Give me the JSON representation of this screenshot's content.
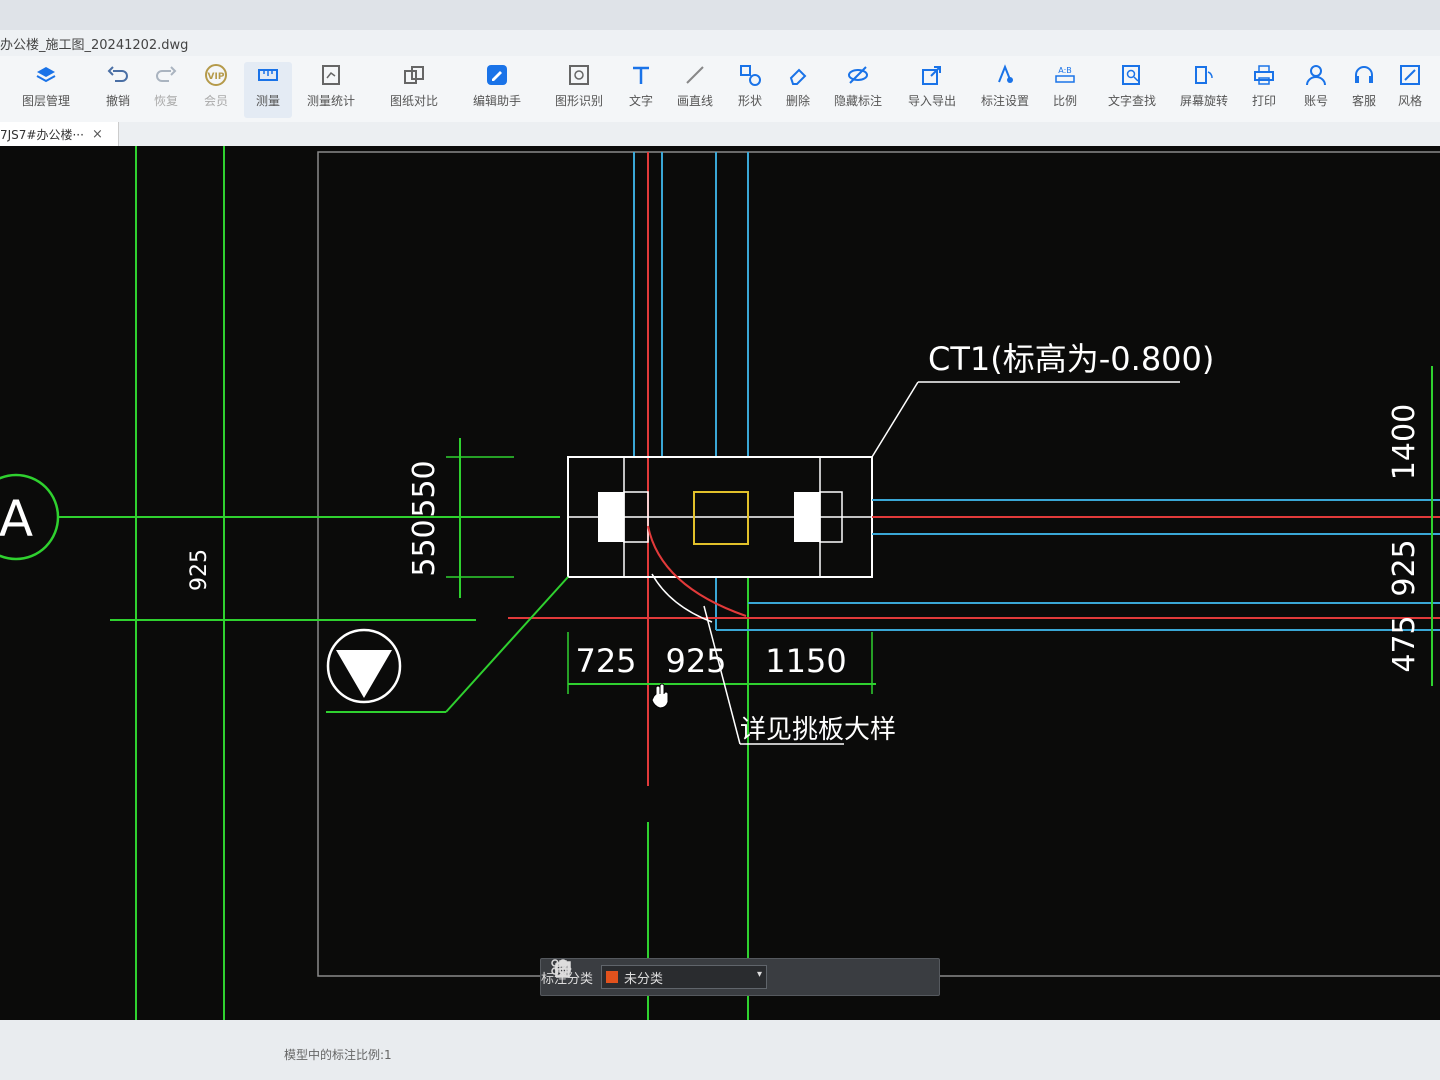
{
  "window": {
    "title": "办公楼_施工图_20241202.dwg"
  },
  "toolbar": {
    "items": [
      {
        "label": "图层管理",
        "icon": "layers-icon"
      },
      {
        "label": "撤销",
        "icon": "undo-icon"
      },
      {
        "label": "恢复",
        "icon": "redo-icon"
      },
      {
        "label": "会员",
        "icon": "vip-icon"
      },
      {
        "label": "测量",
        "icon": "measure-icon"
      },
      {
        "label": "测量统计",
        "icon": "measure-stats-icon"
      },
      {
        "label": "图纸对比",
        "icon": "compare-icon"
      },
      {
        "label": "编辑助手",
        "icon": "edit-assistant-icon"
      },
      {
        "label": "图形识别",
        "icon": "shape-recognize-icon"
      },
      {
        "label": "文字",
        "icon": "text-icon"
      },
      {
        "label": "画直线",
        "icon": "line-icon"
      },
      {
        "label": "形状",
        "icon": "shape-icon"
      },
      {
        "label": "删除",
        "icon": "eraser-icon"
      },
      {
        "label": "隐藏标注",
        "icon": "hide-annotation-icon"
      },
      {
        "label": "导入导出",
        "icon": "import-export-icon"
      },
      {
        "label": "标注设置",
        "icon": "annotation-settings-icon"
      },
      {
        "label": "比例",
        "icon": "scale-icon"
      },
      {
        "label": "文字查找",
        "icon": "text-search-icon"
      },
      {
        "label": "屏幕旋转",
        "icon": "rotate-screen-icon"
      },
      {
        "label": "打印",
        "icon": "print-icon"
      },
      {
        "label": "账号",
        "icon": "account-icon"
      },
      {
        "label": "客服",
        "icon": "headset-icon"
      },
      {
        "label": "风格",
        "icon": "style-icon"
      }
    ]
  },
  "tab": {
    "label": "7JS7#办公楼···",
    "close": "×"
  },
  "drawing": {
    "axis_label": "A",
    "cap_label": "CT1(标高为-0.800)",
    "detail_note": "详见挑板大样",
    "dims": {
      "left": "925",
      "vertical_top": "550",
      "vertical_bottom": "550",
      "horizontal_1": "725",
      "horizontal_2": "925",
      "horizontal_3": "1150",
      "right_1": "1400",
      "right_2": "925",
      "right_3": "475"
    }
  },
  "annotation_bar": {
    "label": "标注分类",
    "selected": "未分类",
    "swatch_color": "#e2521d"
  },
  "status": {
    "text": "模型中的标注比例:1"
  }
}
